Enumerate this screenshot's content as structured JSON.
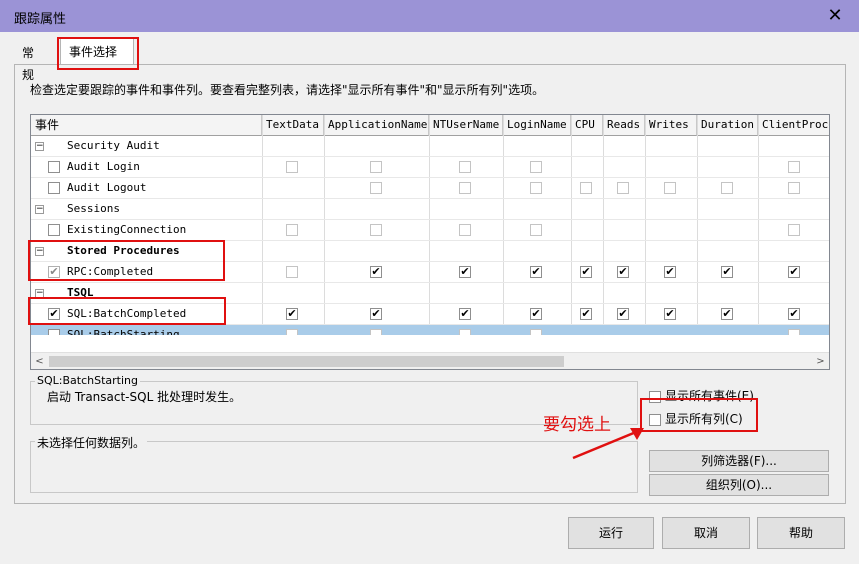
{
  "window": {
    "title": "跟踪属性",
    "close_glyph": "✕"
  },
  "tabs": [
    {
      "label": "常规",
      "active": false
    },
    {
      "label": "事件选择",
      "active": true
    }
  ],
  "hint": "检查选定要跟踪的事件和事件列。要查看完整列表，请选择\"显示所有事件\"和\"显示所有列\"选项。",
  "grid": {
    "columns": [
      "事件",
      "TextData",
      "ApplicationName",
      "NTUserName",
      "LoginName",
      "CPU",
      "Reads",
      "Writes",
      "Duration",
      "ClientProce"
    ],
    "rows": [
      {
        "type": "category",
        "expander": "−",
        "label": "Security Audit",
        "bold": false
      },
      {
        "type": "event",
        "label": "Audit Login",
        "checked": false
      },
      {
        "type": "event",
        "label": "Audit Logout",
        "checked": false
      },
      {
        "type": "category",
        "expander": "−",
        "label": "Sessions",
        "bold": false
      },
      {
        "type": "event",
        "label": "ExistingConnection",
        "checked": false
      },
      {
        "type": "category",
        "expander": "−",
        "label": "Stored Procedures",
        "bold": true
      },
      {
        "type": "event",
        "label": "RPC:Completed",
        "checked": true,
        "grayed": true
      },
      {
        "type": "category",
        "expander": "−",
        "label": "TSQL",
        "bold": true
      },
      {
        "type": "event",
        "label": "SQL:BatchCompleted",
        "checked": true
      },
      {
        "type": "event",
        "label": "SQL:BatchStarting",
        "checked": false,
        "selected": true
      }
    ],
    "cells": [
      [],
      [
        "",
        "",
        "",
        "",
        "",
        "",
        "",
        "",
        ""
      ],
      [
        "",
        "",
        "",
        "",
        "",
        "",
        "",
        "",
        ""
      ],
      [],
      [
        "",
        "",
        "",
        "",
        "",
        "",
        "",
        "",
        ""
      ],
      [],
      [
        "",
        "✔",
        "✔",
        "✔",
        "✔",
        "✔",
        "✔",
        "✔",
        "✔"
      ],
      [],
      [
        "✔",
        "✔",
        "✔",
        "✔",
        "✔",
        "✔",
        "✔",
        "✔",
        "✔"
      ],
      [
        "",
        "",
        "",
        "",
        "",
        "",
        "",
        "",
        ""
      ]
    ],
    "cell_presence": [
      [],
      [
        1,
        1,
        1,
        1,
        0,
        0,
        0,
        0,
        1
      ],
      [
        0,
        1,
        1,
        1,
        1,
        1,
        1,
        1,
        1
      ],
      [],
      [
        1,
        1,
        1,
        1,
        0,
        0,
        0,
        0,
        1
      ],
      [],
      [
        1,
        1,
        1,
        1,
        1,
        1,
        1,
        1,
        1
      ],
      [],
      [
        1,
        1,
        1,
        1,
        1,
        1,
        1,
        1,
        1
      ],
      [
        1,
        1,
        1,
        1,
        0,
        0,
        0,
        0,
        1
      ]
    ],
    "scroll_left_glyph": "<",
    "scroll_right_glyph": ">"
  },
  "description_group": {
    "legend": "SQL:BatchStarting",
    "text": "启动 Transact-SQL 批处理时发生。"
  },
  "column_group": {
    "legend": "未选择任何数据列。"
  },
  "options": {
    "show_all_events": {
      "label": "显示所有事件(E)",
      "checked": false
    },
    "show_all_columns": {
      "label": "显示所有列(C)",
      "checked": false
    }
  },
  "buttons": {
    "column_filters": "列筛选器(F)...",
    "organize_columns": "组织列(O)...",
    "run": "运行",
    "cancel": "取消",
    "help": "帮助"
  },
  "annotation": {
    "text": "要勾选上",
    "color": "#e01010"
  }
}
